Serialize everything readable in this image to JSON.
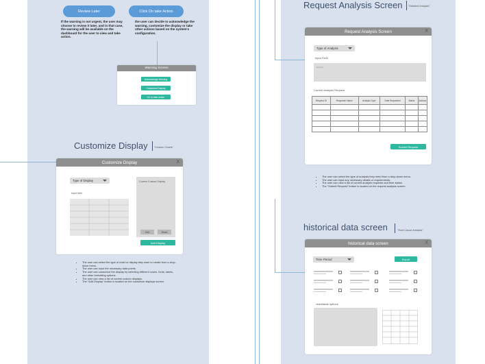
{
  "left": {
    "buttons": {
      "review_later": "Review Later",
      "take_action": "Click On take Action"
    },
    "note_left": "If the warning is not urgent, the user may choose to review it later, and in that case, the warning will be available on the dashboard for the user to view and take action.",
    "note_right": "the user can decide to acknowledge the warning, customize the display or take other actions based on the system's configuration.",
    "warning_screen": {
      "title": "Warning Screen",
      "buttons": [
        "Acknowledge Warning",
        "Customize Display",
        "Go to take action"
      ]
    },
    "customize": {
      "heading": "Customize Display",
      "subtitle": "\"Custom Charts\"",
      "modal_title": "Customize Display",
      "close": "X",
      "select": "Type of Display",
      "input_label": "Input field",
      "current_label": "Current Custom Display",
      "edit": "Edit",
      "reset": "Reset",
      "add": "Add Display",
      "bullets": [
        "The user can select the type of chart or display they want to create from a drop-down menu.",
        "The user can input the necessary data points.",
        "The user can customize the display by selecting different colors, fonts, labels, and other formatting options.",
        "The user can view a list of current custom displays.",
        "The \"Add Display\" button is located on the customize displays screen."
      ]
    }
  },
  "right": {
    "request": {
      "heading": "Request Analysis Screen",
      "subtitle": "\"Detailed Analysis\"",
      "modal_title": "Request Analysis Screen",
      "close": "X",
      "select": "Type of Analysis",
      "input_label": "Input Field",
      "input_placeholder": "Identifier",
      "table_label": "Current Analysis Request",
      "columns": [
        "Request ID",
        "Requester Name",
        "Analysis Type",
        "Date Requested",
        "Status",
        "Actions"
      ],
      "submit": "Submit Request",
      "bullets": [
        "The user can select the type of analysis they need from a drop-down menu.",
        "The user can input any necessary details or requirements.",
        "The user can view a list of current analysis requests and their status.",
        "The \"Submit Request\" button is located on the request analysis screen."
      ]
    },
    "historical": {
      "heading": "historical data screen",
      "subtitle": "\"Root Cause Analysis\"",
      "modal_title": "historical data screen",
      "close": "X",
      "select": "Time Period",
      "export": "Export",
      "chart_label": "chart/table options"
    }
  },
  "colors": {
    "panel": "#d9e1ee",
    "accent_blue": "#5b9bd8",
    "teal": "#2fb8a0",
    "modal_header": "#8f8f8f",
    "heading": "#3d4f6c"
  }
}
